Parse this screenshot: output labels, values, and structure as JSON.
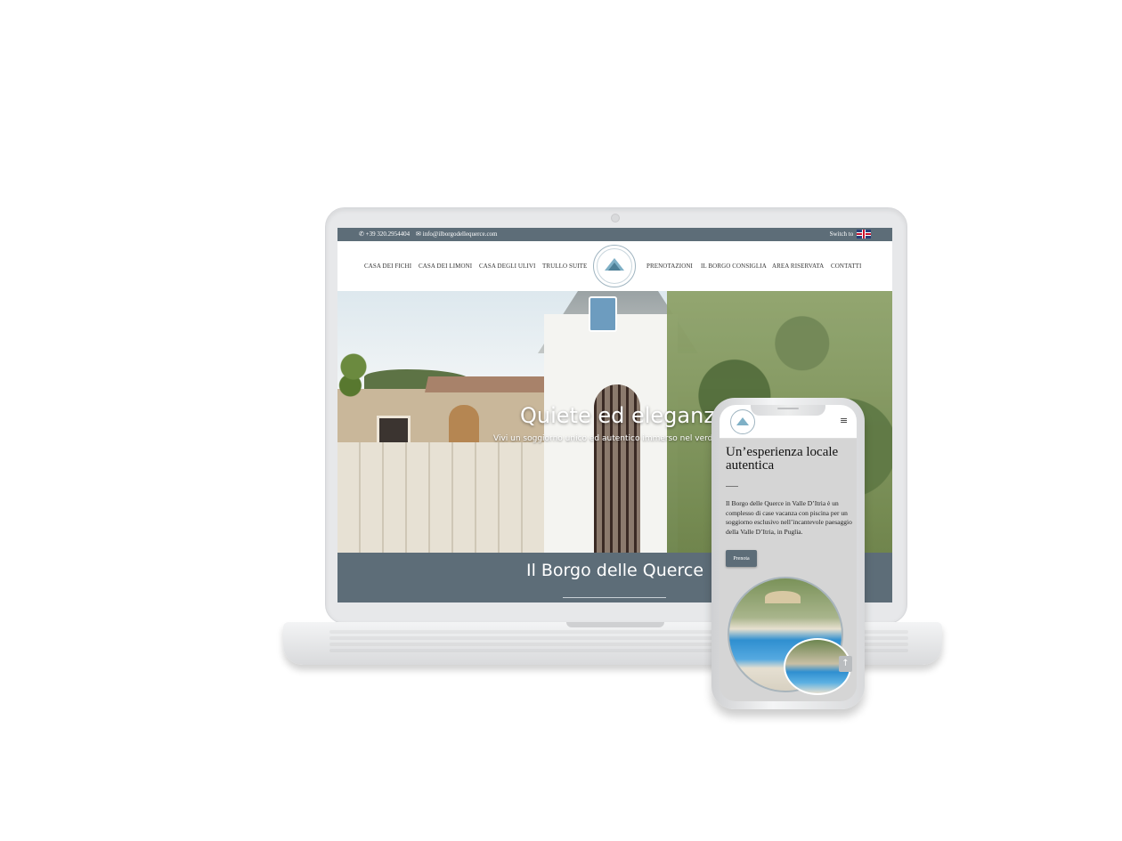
{
  "desktop": {
    "topbar": {
      "phone": "+39 320.2954404",
      "email": "info@ilborgodellequerce.com",
      "switch_label": "Switch to"
    },
    "nav": {
      "items_left": [
        "CASA DEI FICHI",
        "CASA DEI LIMONI",
        "CASA DEGLI ULIVI",
        "TRULLO SUITE"
      ],
      "items_right": [
        "PRENOTAZIONI",
        "IL BORGO CONSIGLIA",
        "AREA RISERVATA",
        "CONTATTI"
      ]
    },
    "hero": {
      "title": "Quiete ed eleganza",
      "subtitle": "Vivi un soggiorno unico ed autentico immerso nel verde della"
    },
    "band": {
      "title": "Il Borgo delle Querce"
    }
  },
  "mobile": {
    "menu_icon": "hamburger-icon",
    "title": "Un’esperienza locale autentica",
    "text": "Il Borgo delle Querce in Valle D’Itria è un complesso di case vacanza con piscina per un soggiorno esclusivo nell’incantevole paesaggio della Valle D’Itria, in Puglia.",
    "button_label": "Prenota",
    "scroll_up_icon": "arrow-up-icon"
  },
  "colors": {
    "brand_slate": "#5d6d78",
    "background": "#ffffff"
  }
}
